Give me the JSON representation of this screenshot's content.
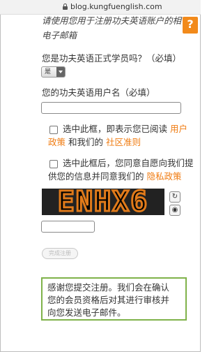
{
  "browser": {
    "url": "blog.kungfuenglish.com"
  },
  "corner_icon": {
    "name": "question-icon",
    "glyph": "?"
  },
  "email_hint": {
    "line1": "请使用您用于注册功夫英语账户的相",
    "line2": "电子邮箱"
  },
  "student_question": {
    "label": "您是功夫英语正式学员吗？（必填）",
    "selected": "是"
  },
  "username": {
    "label": "您的功夫英语用户名（必填）",
    "value": ""
  },
  "agree_terms": {
    "text1": "选中此框，即表示您已阅读",
    "link1": "用户",
    "link1b": "政策",
    "text2": "和我们的",
    "link2": "社区准则"
  },
  "agree_privacy": {
    "text1": "选中此框后，您同意自愿向我们提",
    "text2": "供您的信息并同意我们的",
    "link": "隐私政策"
  },
  "captcha": {
    "code": "ENHX6",
    "input_value": ""
  },
  "submit": {
    "label": "完成注册"
  },
  "thanks": {
    "line1": "感谢您提交注册。我们会在确认",
    "line2": "您的会员资格后对其进行审核并",
    "line3": "向您发送电子邮件。"
  },
  "colors": {
    "accent": "#f07c12",
    "notice_border": "#7fb24a"
  }
}
